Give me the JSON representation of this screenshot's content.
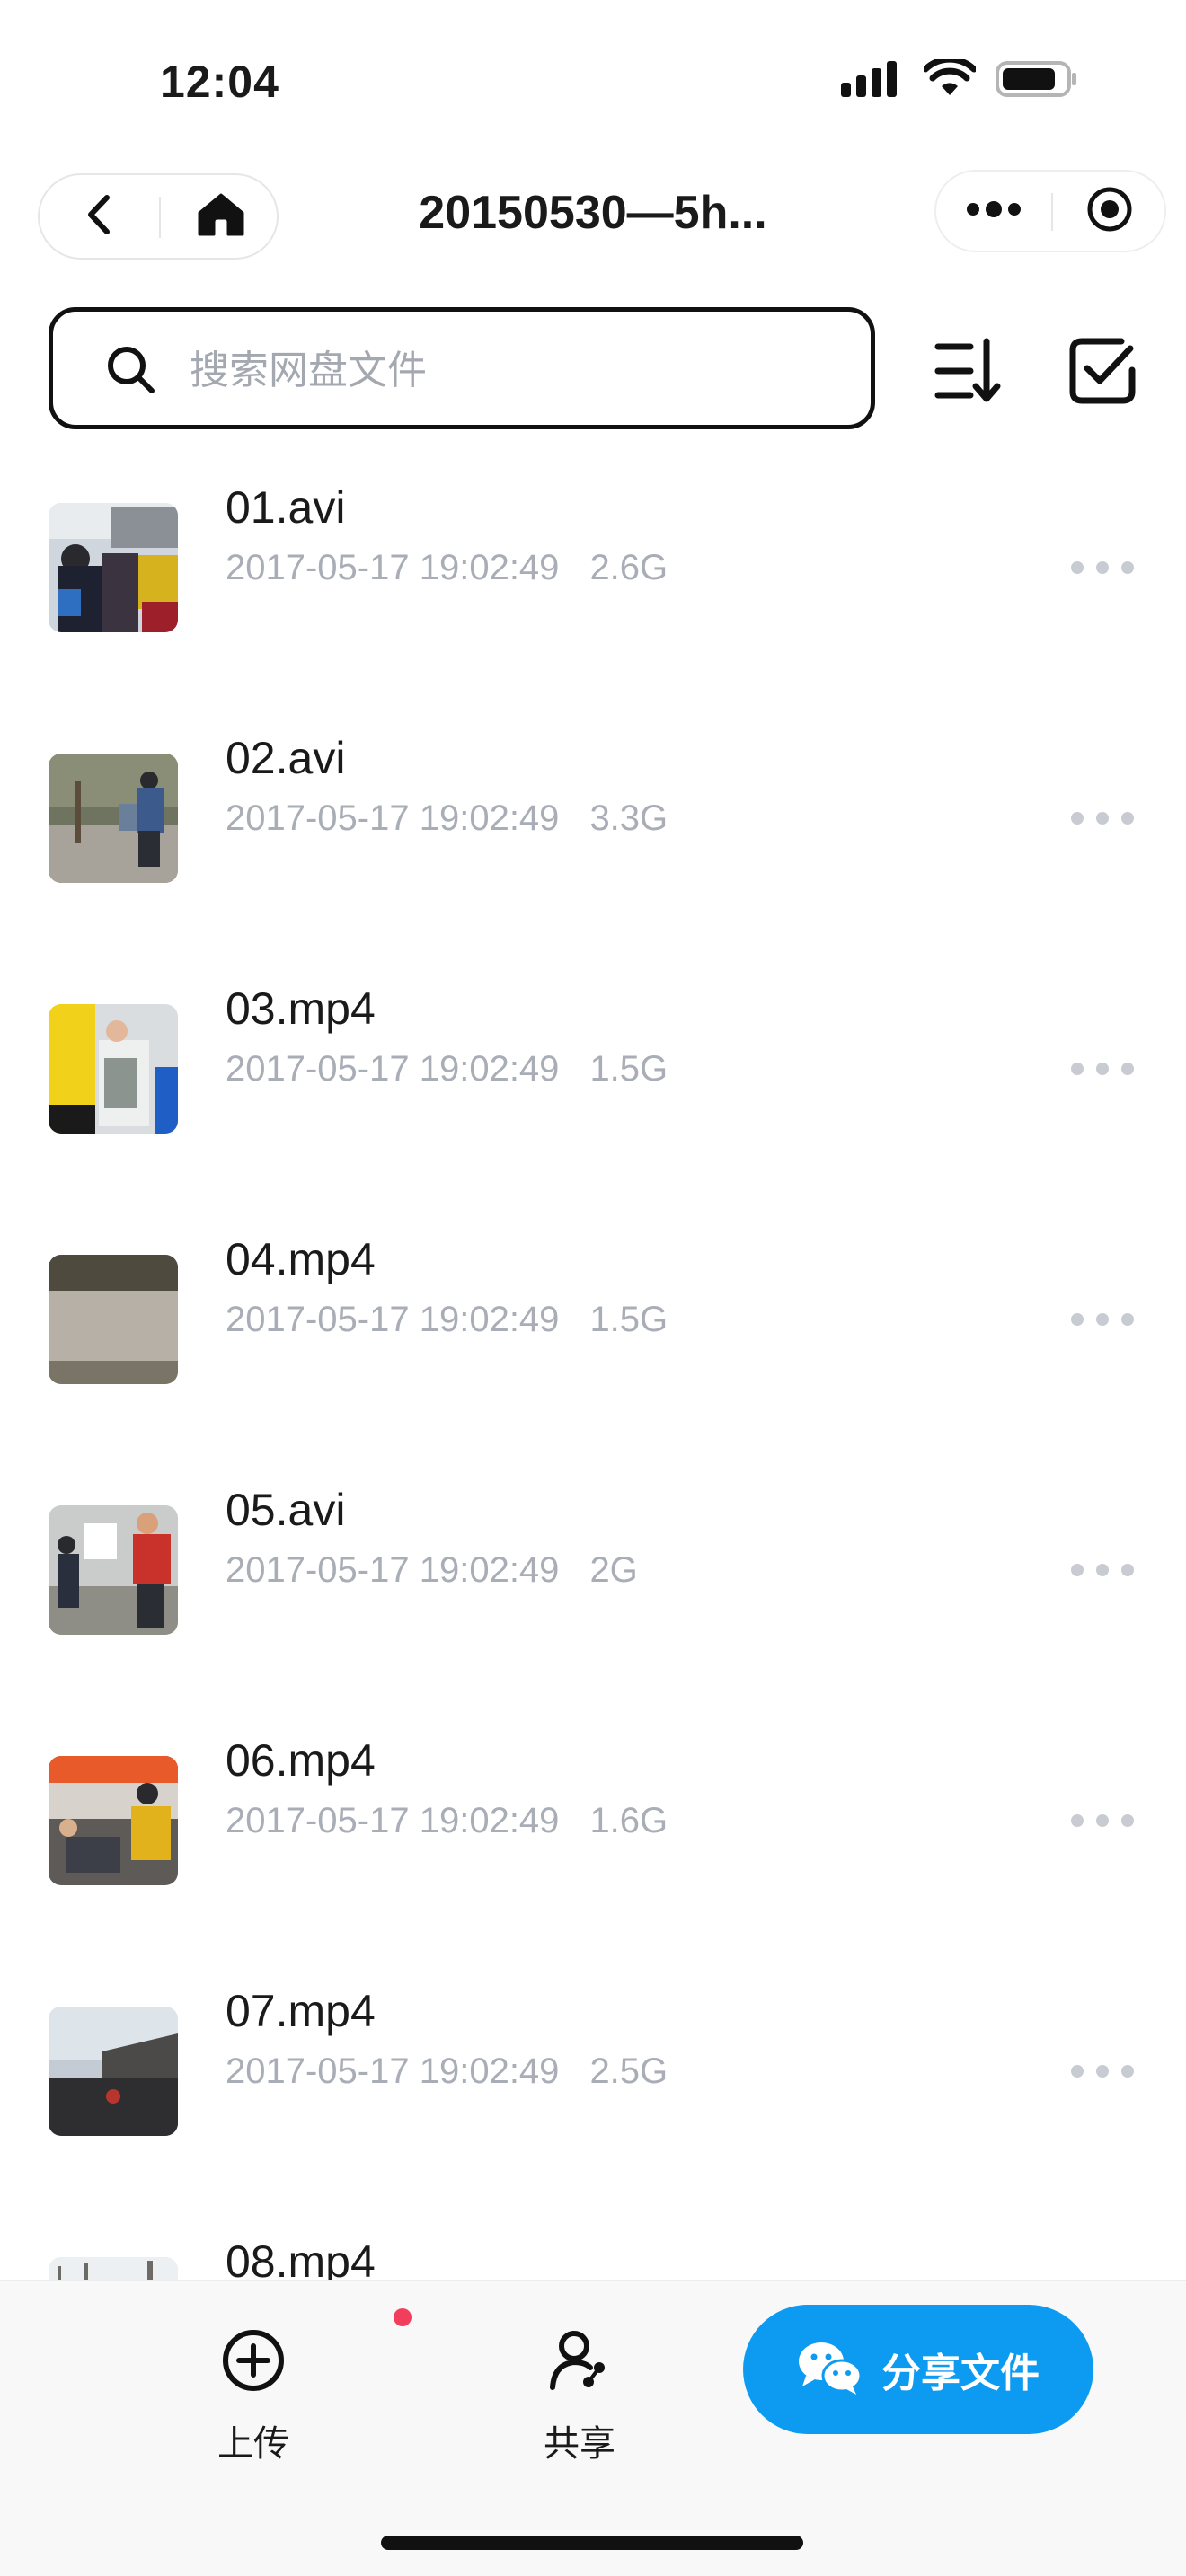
{
  "status_bar": {
    "time": "12:04"
  },
  "navbar": {
    "title": "20150530—5h..."
  },
  "search": {
    "placeholder": "搜索网盘文件"
  },
  "files": [
    {
      "name": "01.avi",
      "date": "2017-05-17 19:02:49",
      "size": "2.6G"
    },
    {
      "name": "02.avi",
      "date": "2017-05-17 19:02:49",
      "size": "3.3G"
    },
    {
      "name": "03.mp4",
      "date": "2017-05-17 19:02:49",
      "size": "1.5G"
    },
    {
      "name": "04.mp4",
      "date": "2017-05-17 19:02:49",
      "size": "1.5G"
    },
    {
      "name": "05.avi",
      "date": "2017-05-17 19:02:49",
      "size": "2G"
    },
    {
      "name": "06.mp4",
      "date": "2017-05-17 19:02:49",
      "size": "1.6G"
    },
    {
      "name": "07.mp4",
      "date": "2017-05-17 19:02:49",
      "size": "2.5G"
    },
    {
      "name": "08.mp4",
      "date": "",
      "size": ""
    }
  ],
  "bottom_bar": {
    "upload_label": "上传",
    "shared_label": "共享",
    "share_file_label": "分享文件"
  },
  "colors": {
    "accent": "#0c9bf0",
    "meta_text": "#a9adb6",
    "badge": "#f23d5c"
  },
  "icons": {
    "back": "chevron-left-icon",
    "home": "home-icon",
    "more": "more-dots-icon",
    "record": "record-icon",
    "search": "search-icon",
    "sort": "sort-icon",
    "select": "checkbox-icon",
    "upload": "plus-circle-icon",
    "shared": "users-icon",
    "wechat": "wechat-icon"
  }
}
